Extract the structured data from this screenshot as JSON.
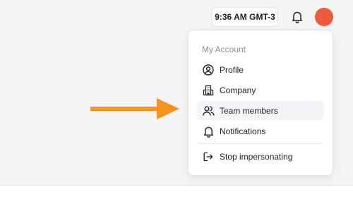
{
  "header": {
    "time": "9:36 AM GMT-3",
    "bell_icon": "bell-icon",
    "avatar_color": "#ee5a3a"
  },
  "account_menu": {
    "heading": "My Account",
    "items": [
      {
        "label": "Profile",
        "icon": "user-circle-icon"
      },
      {
        "label": "Company",
        "icon": "building-icon"
      },
      {
        "label": "Team members",
        "icon": "users-icon",
        "highlighted": true
      },
      {
        "label": "Notifications",
        "icon": "bell-icon"
      }
    ],
    "footer_item": {
      "label": "Stop impersonating",
      "icon": "logout-icon"
    }
  },
  "annotation": {
    "arrow_color": "#f7921e"
  }
}
